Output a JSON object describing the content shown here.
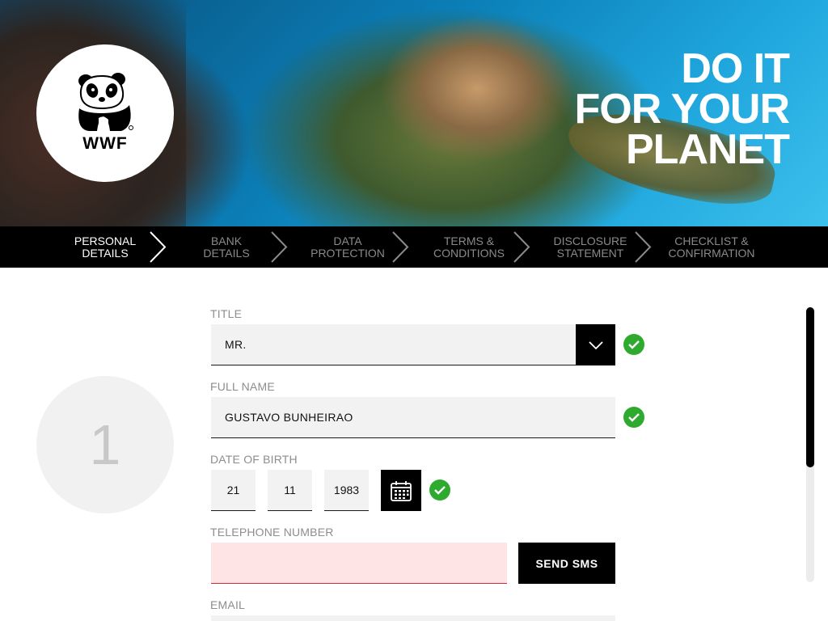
{
  "hero": {
    "logo_text": "WWF",
    "slogan": [
      "DO IT",
      "FOR YOUR",
      "PLANET"
    ]
  },
  "steps": [
    {
      "line1": "PERSONAL",
      "line2": "DETAILS",
      "active": true
    },
    {
      "line1": "BANK",
      "line2": "DETAILS",
      "active": false
    },
    {
      "line1": "DATA",
      "line2": "PROTECTION",
      "active": false
    },
    {
      "line1": "TERMS &",
      "line2": "CONDITIONS",
      "active": false
    },
    {
      "line1": "DISCLOSURE",
      "line2": "STATEMENT",
      "active": false
    },
    {
      "line1": "CHECKLIST &",
      "line2": "CONFIRMATION",
      "active": false
    }
  ],
  "step_number": "1",
  "form": {
    "title": {
      "label": "TITLE",
      "value": "MR."
    },
    "full_name": {
      "label": "FULL NAME",
      "value": "GUSTAVO BUNHEIRAO"
    },
    "dob": {
      "label": "DATE OF BIRTH",
      "day": "21",
      "month": "11",
      "year": "1983"
    },
    "telephone": {
      "label": "TELEPHONE NUMBER",
      "value": "",
      "send_label": "SEND SMS"
    },
    "email": {
      "label": "EMAIL"
    }
  },
  "colors": {
    "accent": "#000000",
    "valid": "#2eaa2e",
    "error_bg": "#ffe4e6",
    "error_line": "#d22d3d",
    "field_bg": "#f2f2f2",
    "label": "#8d8d8d"
  },
  "icons": {
    "logo": "panda-icon",
    "select": "chevron-down-icon",
    "calendar": "calendar-icon",
    "valid": "check-icon",
    "step_separator": "chevron-right-icon"
  }
}
